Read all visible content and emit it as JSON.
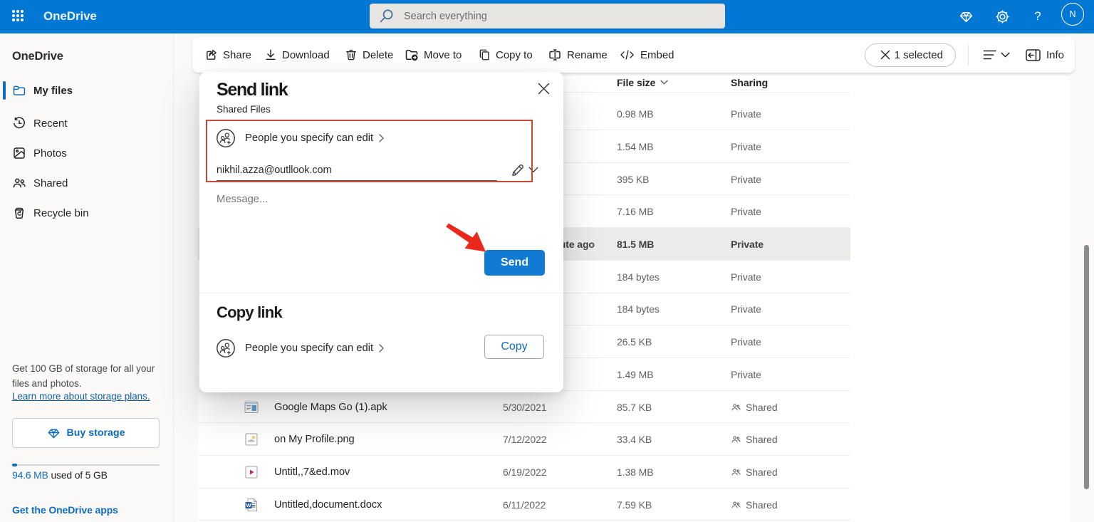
{
  "topbar": {
    "app_title": "OneDrive",
    "search_placeholder": "Search everything",
    "avatar_initial": "N",
    "icons": [
      "waffle",
      "premium-diamond",
      "settings-gear",
      "help",
      "account"
    ]
  },
  "sidebar": {
    "title": "OneDrive",
    "items": [
      {
        "label": "My files",
        "icon": "folder",
        "selected": true
      },
      {
        "label": "Recent",
        "icon": "history",
        "selected": false
      },
      {
        "label": "Photos",
        "icon": "image",
        "selected": false
      },
      {
        "label": "Shared",
        "icon": "people",
        "selected": false
      },
      {
        "label": "Recycle bin",
        "icon": "recycle-bin",
        "selected": false
      }
    ],
    "promo_line1": "Get 100 GB of storage for all your",
    "promo_line2": "files and photos.",
    "promo_link": "Learn more about storage plans.",
    "buy_button": "Buy storage",
    "quota_used": "94.6 MB",
    "quota_rest": " used of 5 GB",
    "apps_link": "Get the OneDrive apps"
  },
  "toolbar": {
    "items": [
      {
        "label": "Share",
        "icon": "share"
      },
      {
        "label": "Download",
        "icon": "download"
      },
      {
        "label": "Delete",
        "icon": "delete"
      },
      {
        "label": "Move to",
        "icon": "move-to"
      },
      {
        "label": "Copy to",
        "icon": "copy-to"
      },
      {
        "label": "Rename",
        "icon": "rename"
      },
      {
        "label": "Embed",
        "icon": "embed"
      }
    ],
    "selection": "1 selected",
    "info_label": "Info"
  },
  "table": {
    "columns": {
      "size": "File size",
      "sharing": "Sharing"
    },
    "rows": [
      {
        "size": "0.98 MB",
        "sharing": "Private"
      },
      {
        "size": "1.54 MB",
        "sharing": "Private"
      },
      {
        "size": "395 KB",
        "sharing": "Private"
      },
      {
        "size": "7.16 MB",
        "sharing": "Private"
      },
      {
        "modified": "About a minute ago",
        "size": "81.5 MB",
        "sharing": "Private",
        "selected": true
      },
      {
        "size": "184 bytes",
        "sharing": "Private"
      },
      {
        "size": "184 bytes",
        "sharing": "Private"
      },
      {
        "size": "26.5 KB",
        "sharing": "Private"
      },
      {
        "size": "1.49 MB",
        "sharing": "Private"
      },
      {
        "name": "Google Maps Go (1).apk",
        "modified": "5/30/2021",
        "size": "85.7 KB",
        "sharing": "Shared",
        "icon": "apk-file"
      },
      {
        "name": "on My Profile.png",
        "modified": "7/12/2022",
        "size": "33.4 KB",
        "sharing": "Shared",
        "icon": "image-file"
      },
      {
        "name": "Untitl,,7&ed.mov",
        "modified": "6/19/2022",
        "size": "1.38 MB",
        "sharing": "Shared",
        "icon": "video-file"
      },
      {
        "name": "Untitled,document.docx",
        "modified": "6/11/2022",
        "size": "7.59 KB",
        "sharing": "Shared",
        "icon": "word-file"
      }
    ]
  },
  "dialog": {
    "title": "Send link",
    "subtitle": "Shared Files",
    "permission_label": "People you specify can edit",
    "email_value": "nikhil.azza@outllook.com",
    "message_placeholder": "Message...",
    "send_button": "Send",
    "copy_section_title": "Copy link",
    "copy_permission_label": "People you specify can edit",
    "copy_button": "Copy",
    "annotation_color": "#c74634",
    "accent_color": "#117bd4"
  }
}
